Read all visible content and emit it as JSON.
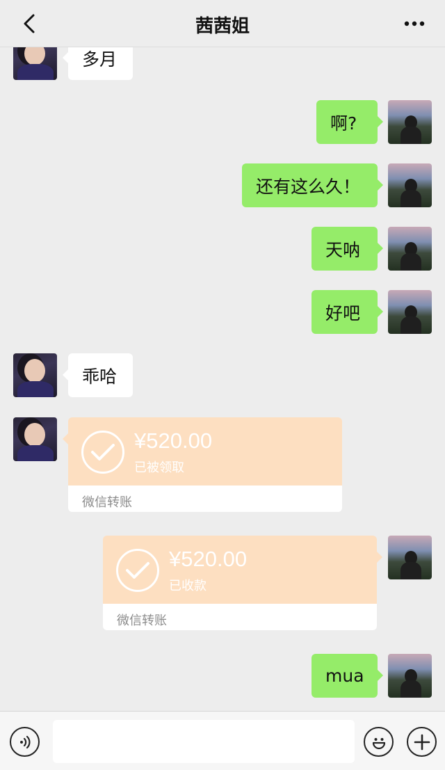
{
  "header": {
    "title": "茜茜姐",
    "back_icon": "chevron-left-icon",
    "more_icon": "ellipsis-icon"
  },
  "messages": [
    {
      "from": "contact",
      "type": "text",
      "text": "多月"
    },
    {
      "from": "me",
      "type": "text",
      "text": "啊?"
    },
    {
      "from": "me",
      "type": "text",
      "text": "还有这么久！"
    },
    {
      "from": "me",
      "type": "text",
      "text": "天呐"
    },
    {
      "from": "me",
      "type": "text",
      "text": "好吧"
    },
    {
      "from": "contact",
      "type": "text",
      "text": "乖哈"
    },
    {
      "from": "contact",
      "type": "transfer",
      "amount": "¥520.00",
      "status": "已被领取",
      "footer": "微信转账"
    },
    {
      "from": "me",
      "type": "transfer",
      "amount": "¥520.00",
      "status": "已收款",
      "footer": "微信转账"
    },
    {
      "from": "me",
      "type": "text",
      "text": "mua"
    }
  ],
  "input_bar": {
    "placeholder": "",
    "voice_icon": "voice-icon",
    "emoji_icon": "emoji-icon",
    "plus_icon": "plus-icon"
  },
  "colors": {
    "background": "#ededed",
    "bubble_out": "#95ec69",
    "bubble_in": "#ffffff",
    "transfer": "#fddfc1"
  }
}
